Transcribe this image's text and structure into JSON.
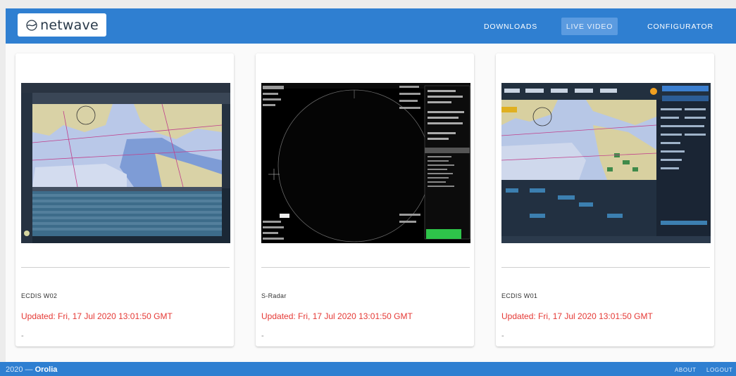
{
  "header": {
    "logo_text": "netwave",
    "nav": {
      "downloads": "DOWNLOADS",
      "live_video": "LIVE VIDEO",
      "configurator": "CONFIGURATOR"
    }
  },
  "cards": [
    {
      "name": "ECDIS W02",
      "updated": "Updated: Fri, 17 Jul 2020 13:01:50 GMT",
      "note": "-"
    },
    {
      "name": "S-Radar",
      "updated": "Updated: Fri, 17 Jul 2020 13:01:50 GMT",
      "note": "-"
    },
    {
      "name": "ECDIS W01",
      "updated": "Updated: Fri, 17 Jul 2020 13:01:50 GMT",
      "note": "-"
    }
  ],
  "footer": {
    "year": "2020 —",
    "brand": "Orolia",
    "about": "ABOUT",
    "logout": "LOGOUT"
  },
  "colors": {
    "primary": "#2f7fd1",
    "updated_text": "#e53935"
  }
}
